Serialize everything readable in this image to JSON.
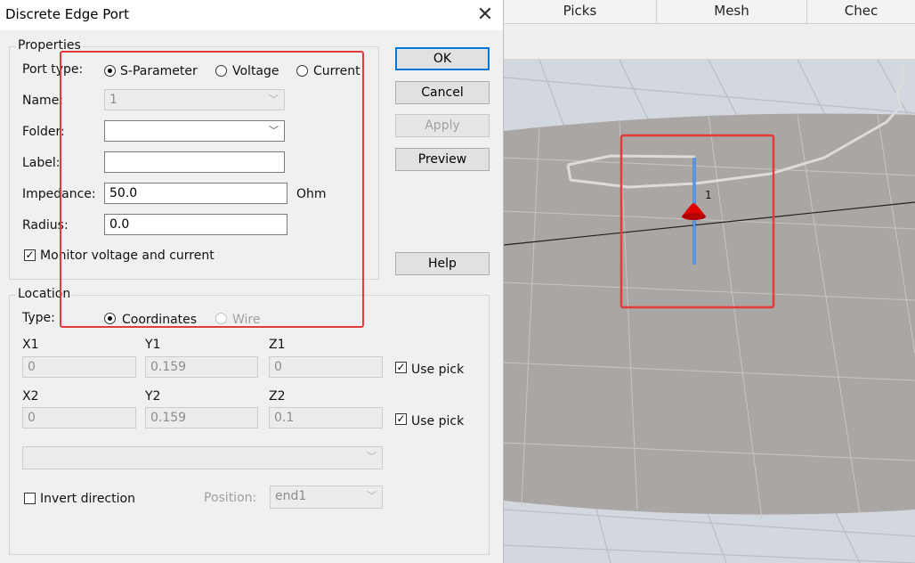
{
  "dialog": {
    "title": "Discrete Edge Port",
    "close_glyph": "✕",
    "buttons": {
      "ok": "OK",
      "cancel": "Cancel",
      "apply": "Apply",
      "preview": "Preview",
      "help": "Help"
    },
    "properties": {
      "legend": "Properties",
      "port_type_label": "Port type:",
      "port_types": [
        "S-Parameter",
        "Voltage",
        "Current"
      ],
      "selected_port_type": "S-Parameter",
      "name_label": "Name:",
      "name_value": "1",
      "folder_label": "Folder:",
      "folder_value": "",
      "label_label": "Label:",
      "label_value": "",
      "impedance_label": "Impedance:",
      "impedance_value": "50.0",
      "impedance_unit": "Ohm",
      "radius_label": "Radius:",
      "radius_value": "0.0",
      "monitor_label": "Monitor voltage and current",
      "monitor_checked": true
    },
    "location": {
      "legend": "Location",
      "type_label": "Type:",
      "types": [
        "Coordinates",
        "Wire"
      ],
      "selected_type": "Coordinates",
      "x1_label": "X1",
      "y1_label": "Y1",
      "z1_label": "Z1",
      "x1": "0",
      "y1": "0.159",
      "z1": "0",
      "x2_label": "X2",
      "y2_label": "Y2",
      "z2_label": "Z2",
      "x2": "0",
      "y2": "0.159",
      "z2": "0.1",
      "use_pick_label": "Use pick",
      "use_pick_1": true,
      "use_pick_2": true,
      "wire_select_value": "",
      "invert_label": "Invert direction",
      "invert_checked": false,
      "position_label": "Position:",
      "position_value": "end1"
    }
  },
  "viewport": {
    "tabs": [
      "Picks",
      "Mesh",
      "Chec"
    ],
    "port_label": "1",
    "colors": {
      "port": "#e10000",
      "edge": "#1f6fe0",
      "highlight": "#e23b3b"
    }
  }
}
